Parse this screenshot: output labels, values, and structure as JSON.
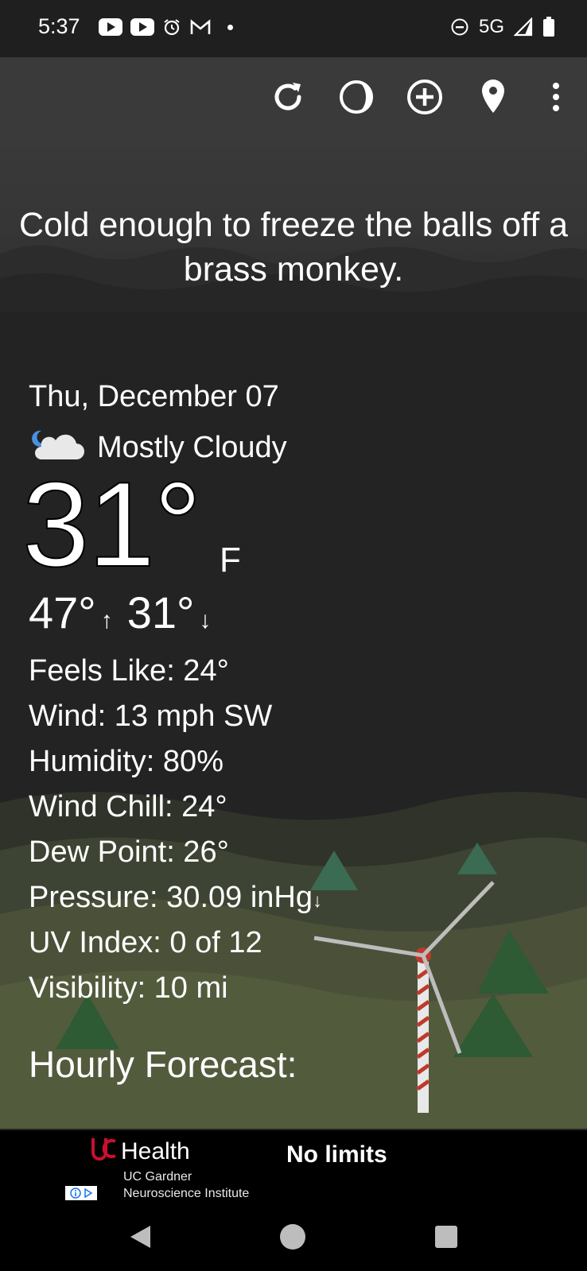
{
  "status_bar": {
    "time": "5:37",
    "network": "5G",
    "left_icons": [
      "youtube-icon",
      "youtube-icon",
      "alarm-icon",
      "gmail-icon",
      "dot-icon"
    ],
    "right_icons": [
      "dnd-icon",
      "signal-icon",
      "battery-icon"
    ]
  },
  "toolbar": {
    "icons": [
      "refresh-icon",
      "theme-icon",
      "add-location-icon",
      "location-pin-icon",
      "more-options-icon"
    ]
  },
  "hero": {
    "quip": "Cold enough to freeze the balls off a brass monkey."
  },
  "current": {
    "date": "Thu, December 07",
    "condition": "Mostly Cloudy",
    "condition_icon": "moon-cloud-icon",
    "temperature": "31°",
    "unit": "F",
    "high": "47°",
    "low": "31°",
    "high_arrow": "↑",
    "low_arrow": "↓"
  },
  "details": {
    "feels_like": "Feels Like:  24°",
    "wind": "Wind:  13 mph SW",
    "humidity": "Humidity:  80%",
    "wind_chill": "Wind Chill:  24°",
    "dew_point": "Dew Point:  26°",
    "pressure": "Pressure:  30.09 inHg",
    "pressure_trend": "↓",
    "uv_index": "UV Index:  0 of 12",
    "visibility": "Visibility:  10 mi"
  },
  "hourly": {
    "title": "Hourly Forecast:"
  },
  "ad": {
    "brand": "Health",
    "subtitle_line1": "UC Gardner",
    "subtitle_line2": "Neuroscience Institute",
    "cta": "No limits"
  },
  "colors": {
    "background": "#232323",
    "toolbar": "#3a3a3a",
    "text": "#ffffff",
    "ad_brand_red": "#c8102e"
  }
}
